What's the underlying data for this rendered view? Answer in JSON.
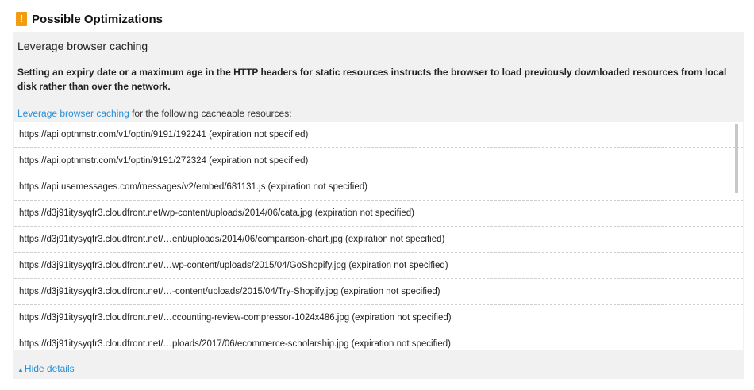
{
  "header": {
    "icon": "!",
    "icon_name": "warning-icon",
    "title": "Possible Optimizations",
    "accent": "#f39c12"
  },
  "rule": {
    "title": "Leverage browser caching",
    "description": "Setting an expiry date or a maximum age in the HTTP headers for static resources instructs the browser to load previously downloaded resources from local disk rather than over the network.",
    "intro_link": "Leverage browser caching",
    "intro_text": " for the following cacheable resources:"
  },
  "resources": [
    "https://api.optnmstr.com/v1/optin/9191/192241 (expiration not specified)",
    "https://api.optnmstr.com/v1/optin/9191/272324 (expiration not specified)",
    "https://api.usemessages.com/messages/v2/embed/681131.js (expiration not specified)",
    "https://d3j91itysyqfr3.cloudfront.net/wp-content/uploads/2014/06/cata.jpg (expiration not specified)",
    "https://d3j91itysyqfr3.cloudfront.net/…ent/uploads/2014/06/comparison-chart.jpg (expiration not specified)",
    "https://d3j91itysyqfr3.cloudfront.net/…wp-content/uploads/2015/04/GoShopify.jpg (expiration not specified)",
    "https://d3j91itysyqfr3.cloudfront.net/…-content/uploads/2015/04/Try-Shopify.jpg (expiration not specified)",
    "https://d3j91itysyqfr3.cloudfront.net/…ccounting-review-compressor-1024x486.jpg (expiration not specified)",
    "https://d3j91itysyqfr3.cloudfront.net/…ploads/2017/06/ecommerce-scholarship.jpg (expiration not specified)"
  ],
  "footer": {
    "hide_caret": "▲",
    "hide_label": "Hide details"
  }
}
